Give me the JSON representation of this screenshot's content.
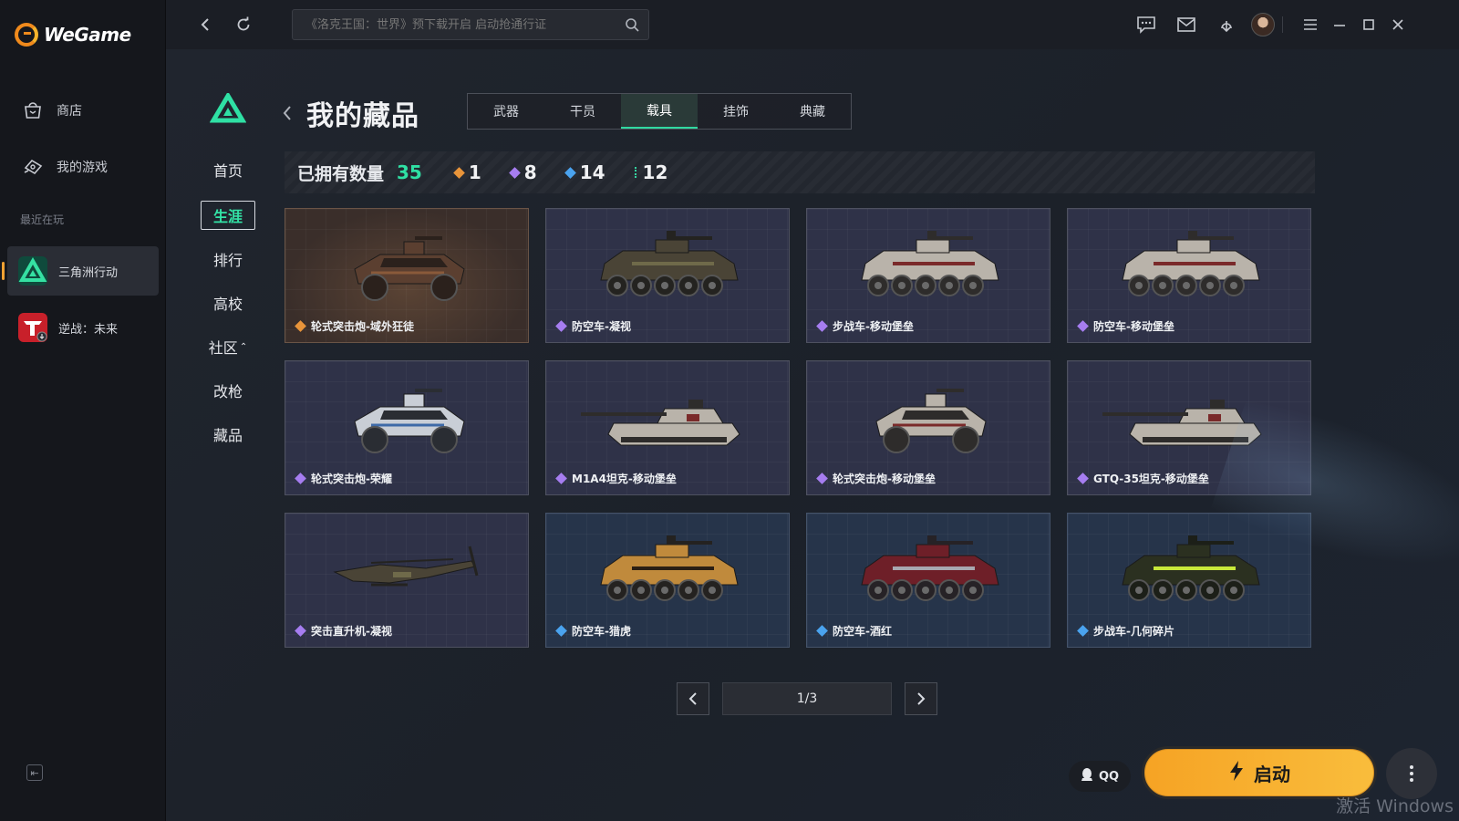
{
  "app": {
    "logo_text": "WeGame"
  },
  "sidebar": {
    "nav": [
      {
        "label": "商店",
        "icon": "shop-bag-icon"
      },
      {
        "label": "我的游戏",
        "icon": "gamepad-icon"
      }
    ],
    "recent_heading": "最近在玩",
    "recent": [
      {
        "label": "三角洲行动",
        "icon": "delta-force-game-icon",
        "active": true
      },
      {
        "label": "逆战：未来",
        "icon": "nizhan-game-icon",
        "active": false
      }
    ]
  },
  "topbar": {
    "search_placeholder": "《洛克王国：世界》预下载开启 启动抢通行证",
    "icons": [
      "back-icon",
      "refresh-icon",
      "search-icon",
      "chat-icon",
      "mail-icon",
      "download-icon",
      "avatar",
      "menu-icon",
      "minimize-icon",
      "maximize-icon",
      "close-icon"
    ]
  },
  "game_nav": {
    "items": [
      "首页",
      "生涯",
      "排行",
      "高校",
      "社区",
      "改枪",
      "藏品"
    ],
    "active": "生涯"
  },
  "page": {
    "title": "我的藏品",
    "tabs": [
      "武器",
      "干员",
      "载具",
      "挂饰",
      "典藏"
    ],
    "active_tab": "载具"
  },
  "summary": {
    "label": "已拥有数量",
    "total": "35",
    "rarities": [
      {
        "tier": "orange",
        "color": "#e8943a",
        "count": "1"
      },
      {
        "tier": "purple",
        "color": "#a67df0",
        "count": "8"
      },
      {
        "tier": "blue",
        "color": "#4aa3ef",
        "count": "14"
      },
      {
        "tier": "green",
        "color": "#35d3a0",
        "count": "12"
      }
    ]
  },
  "items": [
    {
      "name": "轮式突击炮-域外狂徒",
      "rarity": "orange",
      "vehicle": "buggy",
      "paint": "rust"
    },
    {
      "name": "防空车-凝视",
      "rarity": "purple",
      "vehicle": "apc",
      "paint": "camo"
    },
    {
      "name": "步战车-移动堡垒",
      "rarity": "purple",
      "vehicle": "apc",
      "paint": "white"
    },
    {
      "name": "防空车-移动堡垒",
      "rarity": "purple",
      "vehicle": "apc",
      "paint": "white"
    },
    {
      "name": "轮式突击炮-荣耀",
      "rarity": "purple",
      "vehicle": "buggy",
      "paint": "bluewhite"
    },
    {
      "name": "M1A4坦克-移动堡垒",
      "rarity": "purple",
      "vehicle": "tank",
      "paint": "white"
    },
    {
      "name": "轮式突击炮-移动堡垒",
      "rarity": "purple",
      "vehicle": "buggy",
      "paint": "white"
    },
    {
      "name": "GTQ-35坦克-移动堡垒",
      "rarity": "purple",
      "vehicle": "tank",
      "paint": "white"
    },
    {
      "name": "突击直升机-凝视",
      "rarity": "purple",
      "vehicle": "heli",
      "paint": "camo"
    },
    {
      "name": "防空车-猎虎",
      "rarity": "blue",
      "vehicle": "apc",
      "paint": "tiger"
    },
    {
      "name": "防空车-酒红",
      "rarity": "blue",
      "vehicle": "apc",
      "paint": "wine"
    },
    {
      "name": "步战车-几何碎片",
      "rarity": "blue",
      "vehicle": "apc",
      "paint": "neon"
    }
  ],
  "pager": {
    "text": "1/3",
    "prev_icon": "chevron-left-icon",
    "next_icon": "chevron-right-icon"
  },
  "actions": {
    "qq_label": "QQ",
    "launch_label": "启动"
  },
  "watermark": "激活 Windows"
}
